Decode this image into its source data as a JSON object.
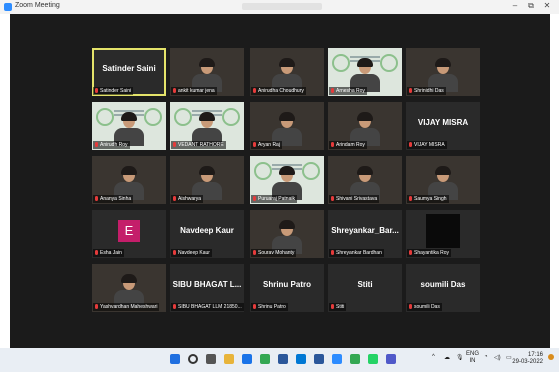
{
  "window": {
    "title": "Zoom Meeting",
    "minimize_glyph": "–",
    "restore_glyph": "⧉",
    "close_glyph": "✕"
  },
  "tiles": [
    {
      "id": "satinder",
      "display": "Satinder Saini",
      "name": "Satinder Saini",
      "type": "text",
      "active": true
    },
    {
      "id": "ankit",
      "name": "ankit kumar jena",
      "type": "video"
    },
    {
      "id": "anirudha",
      "name": "Anirudha Choudhury",
      "type": "video"
    },
    {
      "id": "arnesha",
      "name": "Arnesha Roy",
      "type": "video"
    },
    {
      "id": "shrinidhi",
      "name": "Shrinidhi Das",
      "type": "video"
    },
    {
      "id": "anindo",
      "name": "Anirudh Roy",
      "type": "slide"
    },
    {
      "id": "vedant",
      "name": "VEDANT RATHORE",
      "type": "slide"
    },
    {
      "id": "aryan",
      "name": "Aryan Raj",
      "type": "video"
    },
    {
      "id": "arindam",
      "name": "Arindam Roy",
      "type": "video"
    },
    {
      "id": "vijay",
      "display": "VIJAY MISRA",
      "name": "VIJAY MISRA",
      "type": "text"
    },
    {
      "id": "ananya",
      "name": "Ananya Sinha",
      "type": "video"
    },
    {
      "id": "aishwarya",
      "name": "Aishwarya",
      "type": "video"
    },
    {
      "id": "puruaraj",
      "name": "Puruaraj Patnaik",
      "type": "slide"
    },
    {
      "id": "shivani",
      "name": "Shivani Srivastava",
      "type": "video"
    },
    {
      "id": "saumya",
      "name": "Saumya Singh",
      "type": "video"
    },
    {
      "id": "esha",
      "name": "Esha Jain",
      "type": "avatar",
      "initial": "E"
    },
    {
      "id": "navdeep",
      "display": "Navdeep Kaur",
      "name": "Navdeep Kaur",
      "type": "text"
    },
    {
      "id": "sourav",
      "name": "Sourav Mohanty",
      "type": "video"
    },
    {
      "id": "shreyankar",
      "display": "Shreyankar_Bar...",
      "name": "Shreyankar Bardhan",
      "type": "text"
    },
    {
      "id": "shayantika",
      "name": "Shayantika Roy",
      "type": "black"
    },
    {
      "id": "yashvardhan",
      "name": "Yashvardhan Maheshwari",
      "type": "video"
    },
    {
      "id": "sibu",
      "display": "SIBU BHAGAT L...",
      "name": "SIBU BHAGAT LLM 21850...",
      "type": "text"
    },
    {
      "id": "shrinu",
      "display": "Shrinu Patro",
      "name": "Shrinu Patro",
      "type": "text"
    },
    {
      "id": "stiti",
      "display": "Stiti",
      "name": "Stiti",
      "type": "text"
    },
    {
      "id": "soumili",
      "display": "soumili Das",
      "name": "soumili Das",
      "type": "text"
    }
  ],
  "taskbar": {
    "icons": [
      "windows-icon",
      "search-icon",
      "taskview-icon",
      "files-icon",
      "edge-icon",
      "chrome-icon",
      "store-icon",
      "mail-icon",
      "word-icon",
      "zoom-icon",
      "chrome-icon",
      "whatsapp-icon",
      "teams-icon"
    ],
    "lang": "ENG",
    "region": "IN",
    "time": "17:16",
    "date": "29-03-2022"
  },
  "colors": {
    "active_border": "#e4e36a",
    "accent": "#2d8cff",
    "muted_mic": "#e53b3b"
  }
}
